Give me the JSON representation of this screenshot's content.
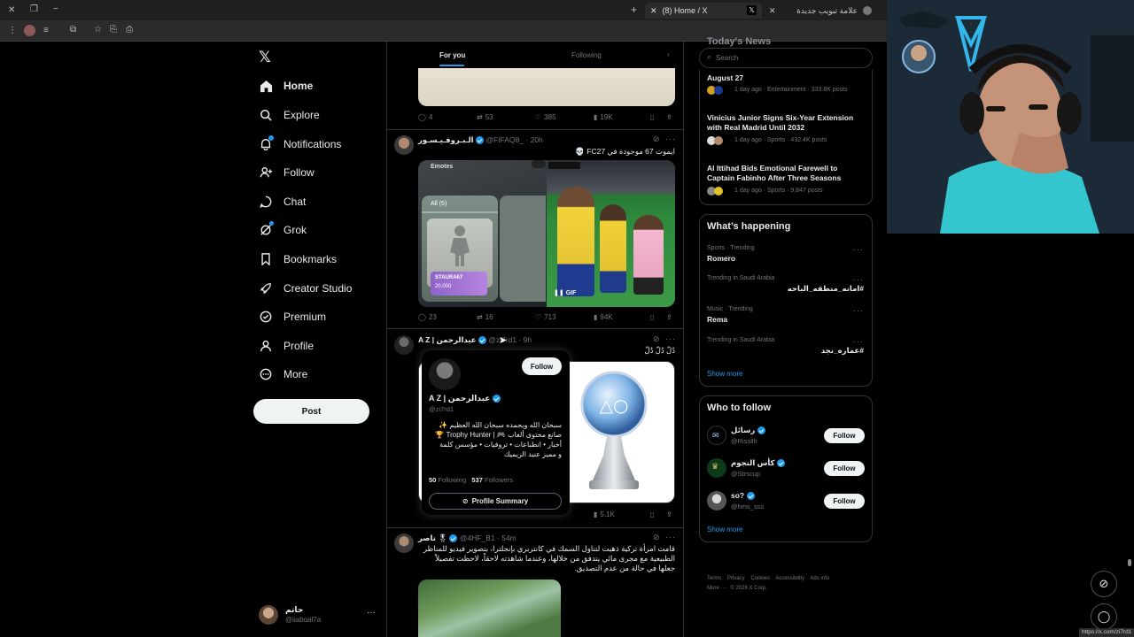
{
  "browser": {
    "tabs": [
      {
        "label": "(8) Home / X"
      },
      {
        "label": "علامة تبويب جديدة"
      }
    ],
    "status_url": "https://x.com/zi7rd1"
  },
  "nav": {
    "items": [
      {
        "label": "Home",
        "icon": "home-icon"
      },
      {
        "label": "Explore",
        "icon": "search-icon"
      },
      {
        "label": "Notifications",
        "icon": "bell-icon"
      },
      {
        "label": "Follow",
        "icon": "person-add-icon"
      },
      {
        "label": "Chat",
        "icon": "chat-icon"
      },
      {
        "label": "Grok",
        "icon": "grok-icon"
      },
      {
        "label": "Bookmarks",
        "icon": "bookmark-icon"
      },
      {
        "label": "Creator Studio",
        "icon": "rocket-icon"
      },
      {
        "label": "Premium",
        "icon": "premium-icon"
      },
      {
        "label": "Profile",
        "icon": "profile-icon"
      },
      {
        "label": "More",
        "icon": "more-circle-icon"
      }
    ],
    "post_label": "Post",
    "account": {
      "name": "حاتم",
      "handle": "@iiaboal7a"
    }
  },
  "feed": {
    "tabs": {
      "for_you": "For you",
      "following": "Following"
    },
    "post0_actions": {
      "replies": "4",
      "reposts": "53",
      "likes": "385",
      "views": "19K"
    },
    "post1": {
      "name": "الـبـروفـيـسـور",
      "handle": "@FIFAQ8_",
      "time": "20h",
      "text": "ايموت 67 موجودة في FC27 💀",
      "media_left": {
        "title": "Emotes",
        "tab": "All (5)",
        "card_name": "STAURA67",
        "card_value": "20,000"
      },
      "gif_label": "GIF",
      "actions": {
        "replies": "23",
        "reposts": "16",
        "likes": "713",
        "views": "94K"
      }
    },
    "post2": {
      "name": "عبدالرحمن | A Z",
      "handle": "@zi7rd1",
      "time": "9h",
      "text": "دُلّ دُلّ دُلّ",
      "views": "5.1K"
    },
    "hovercard": {
      "follow_label": "Follow",
      "name": "عبدالرحمن | A Z",
      "handle": "@zi7rd1",
      "bio_line1": "سبحان الله وبحمده سبحان الله العظيم ✨",
      "bio_line2": "صانع محتوى ألعاب 🎮 | Trophy Hunter 🏆",
      "bio_line3": "أخبار • انطباعات • تروفيات • مؤسس كلمة",
      "bio_line4": "و مميز عنيد الريميك",
      "following_count": "50",
      "following_label": "Following",
      "followers_count": "537",
      "followers_label": "Followers",
      "summary_label": "Profile Summary"
    },
    "post3": {
      "name": "ناصر",
      "handle": "@4HF_B1",
      "time": "54m",
      "text": "قامت امرأة تركية ذهبت لتناول السمك في كانتربري بإنجلترا، بتصوير فيديو للمناظر الطبيعية مع مجرى مائي يتدفق من خلالها، وعندما شاهدته لاحقاً، لاحظت تفصيلاً جعلها في حالة من عدم التصديق."
    }
  },
  "right": {
    "search_placeholder": "Search",
    "news": [
      {
        "title": "August 27",
        "meta": "1 day ago · Entertainment · 333.8K posts"
      },
      {
        "title": "Vinicius Junior Signs Six-Year Extension with Real Madrid Until 2032",
        "meta": "1 day ago · Sports · 432.4K posts"
      },
      {
        "title": "Al Ittihad Bids Emotional Farewell to Captain Fabinho After Three Seasons",
        "meta": "1 day ago · Sports · 9,847 posts"
      }
    ],
    "whats_happening": {
      "title": "What’s happening",
      "trends": [
        {
          "meta": "Sports · Trending",
          "name": "Romero"
        },
        {
          "meta": "Trending in Saudi Arabia",
          "name": "#امانه_منطقه_الباحه"
        },
        {
          "meta": "Music · Trending",
          "name": "Rema"
        },
        {
          "meta": "Trending in Saudi Arabia",
          "name": "#عماره_نجد"
        }
      ],
      "show_more": "Show more"
    },
    "who_to_follow": {
      "title": "Who to follow",
      "users": [
        {
          "name": "رسائل",
          "handle": "@Rissllh"
        },
        {
          "name": "كأس النجوم",
          "handle": "@Strscup"
        },
        {
          "name": "so?",
          "handle": "@hms_sss"
        }
      ],
      "follow_label": "Follow",
      "show_more": "Show more"
    },
    "footer": {
      "links": [
        "Terms",
        "Privacy",
        "Cookies",
        "Accessibility",
        "Ads info"
      ],
      "more": "More ···",
      "copyright": "© 2026 X Corp."
    }
  },
  "colors": {
    "accent": "#1d9bf0",
    "background": "#000000",
    "border": "#2f3336",
    "muted": "#71767b",
    "webcam_wall": "#1b2a36",
    "shirt": "#35c5cf"
  }
}
